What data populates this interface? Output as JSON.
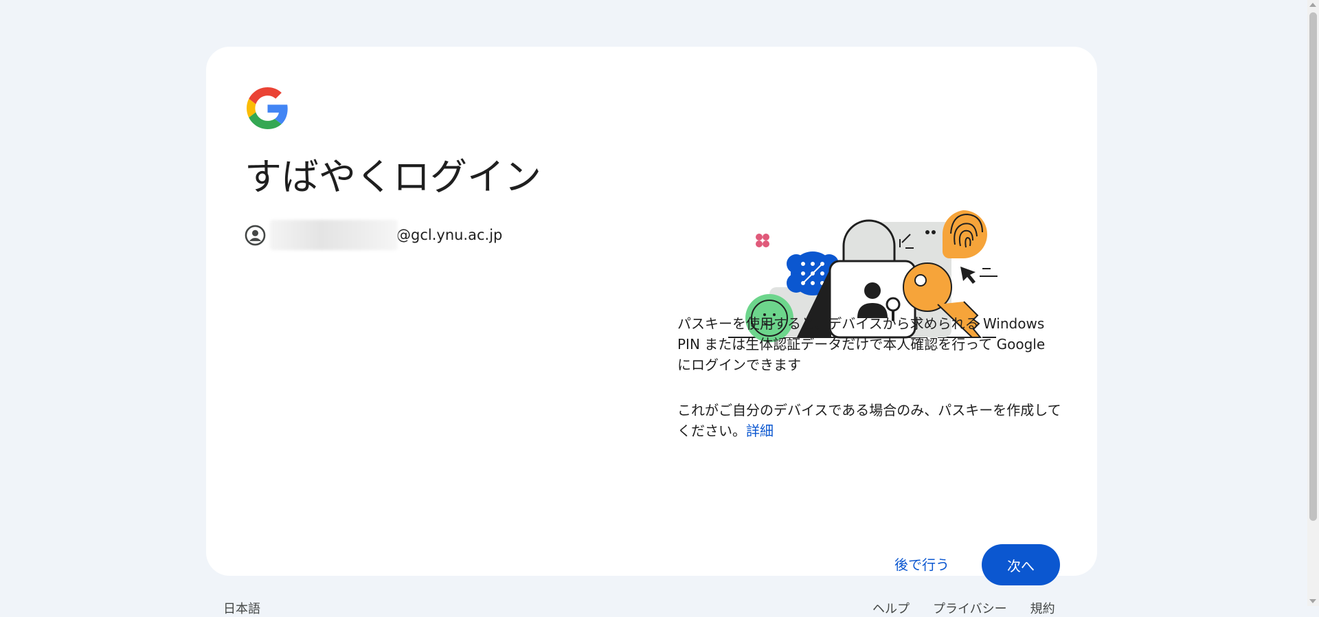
{
  "header": {
    "logo_icon": "google-g-logo"
  },
  "main": {
    "title": "すばやくログイン",
    "account": {
      "icon": "account-circle-icon",
      "email_domain": "@gcl.ynu.ac.jp"
    },
    "illustration": "passkey-illustration",
    "description_1": "パスキーを使用すると、デバイスから求められる Windows PIN または生体認証データだけで本人確認を行って Google にログインできます",
    "description_2": "これがご自分のデバイスである場合のみ、パスキーを作成してください。",
    "details_link": "詳細"
  },
  "actions": {
    "later_label": "後で行う",
    "next_label": "次へ"
  },
  "footer": {
    "language": "日本語",
    "links": [
      "ヘルプ",
      "プライバシー",
      "規約"
    ]
  },
  "colors": {
    "background": "#f0f4f9",
    "card": "#ffffff",
    "accent": "#0b57d0"
  }
}
